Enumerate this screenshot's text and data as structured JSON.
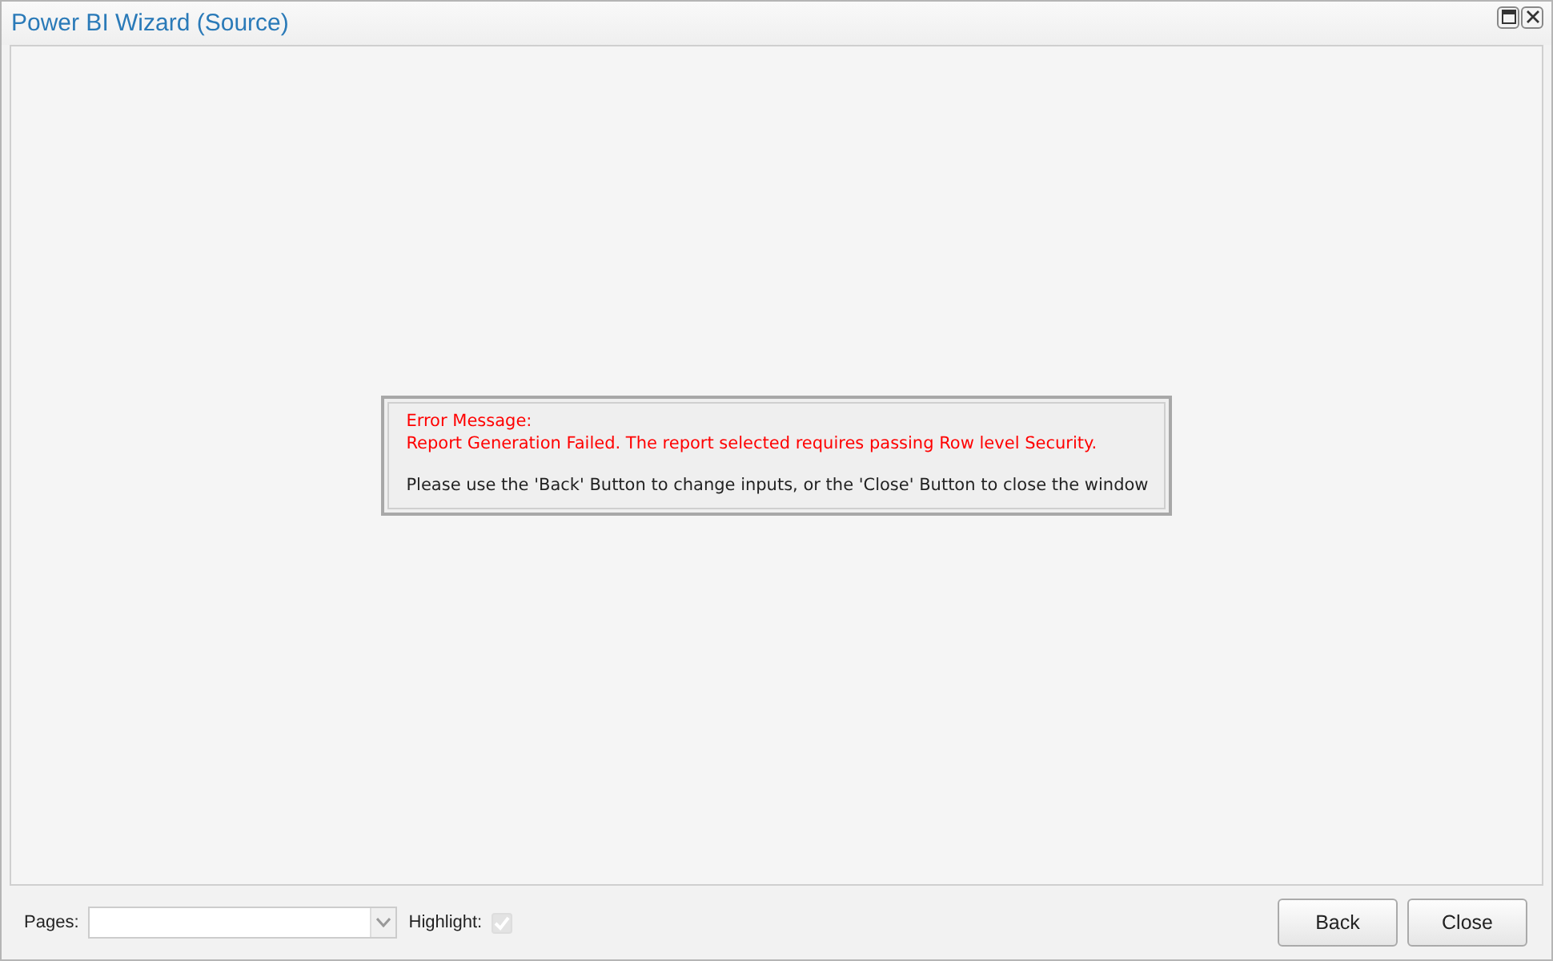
{
  "window": {
    "title": "Power BI Wizard (Source)"
  },
  "error": {
    "heading": "Error Message:",
    "message": "Report Generation Failed. The report selected requires passing Row level Security.",
    "hint": "Please use the 'Back' Button to change inputs, or the 'Close' Button to close the window"
  },
  "footer": {
    "pages_label": "Pages:",
    "highlight_label": "Highlight:",
    "highlight": {
      "checked": true,
      "disabled": true
    }
  },
  "buttons": [
    "Back",
    "Close"
  ]
}
